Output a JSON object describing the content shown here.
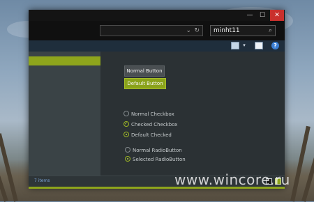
{
  "window": {
    "controls": {
      "minimize": "—",
      "maximize": "☐",
      "close": "✕"
    }
  },
  "address_bar": {
    "path": "",
    "dropdown_glyph": "⌄",
    "refresh_glyph": "↻"
  },
  "search": {
    "value": "minht11",
    "icon": "⌕"
  },
  "toolbar": {
    "view_dropdown_glyph": "▾",
    "help_glyph": "?"
  },
  "content": {
    "normal_button": "Normal Button",
    "default_button": "Default Button",
    "checkboxes": [
      {
        "label": "Normal Checkbox",
        "state": "unchecked"
      },
      {
        "label": "Checked Checkbox",
        "state": "checked"
      },
      {
        "label": "Default Checked",
        "state": "dot"
      }
    ],
    "radios": [
      {
        "label": "Normal RadioButton",
        "state": "unchecked"
      },
      {
        "label": "Selected RadioButton",
        "state": "selected"
      }
    ]
  },
  "status": {
    "item_count": "7 items"
  },
  "watermark": "www.wincore.ru",
  "colors": {
    "accent": "#8ea51c",
    "close": "#c9302c",
    "pane": "#2b3134"
  }
}
